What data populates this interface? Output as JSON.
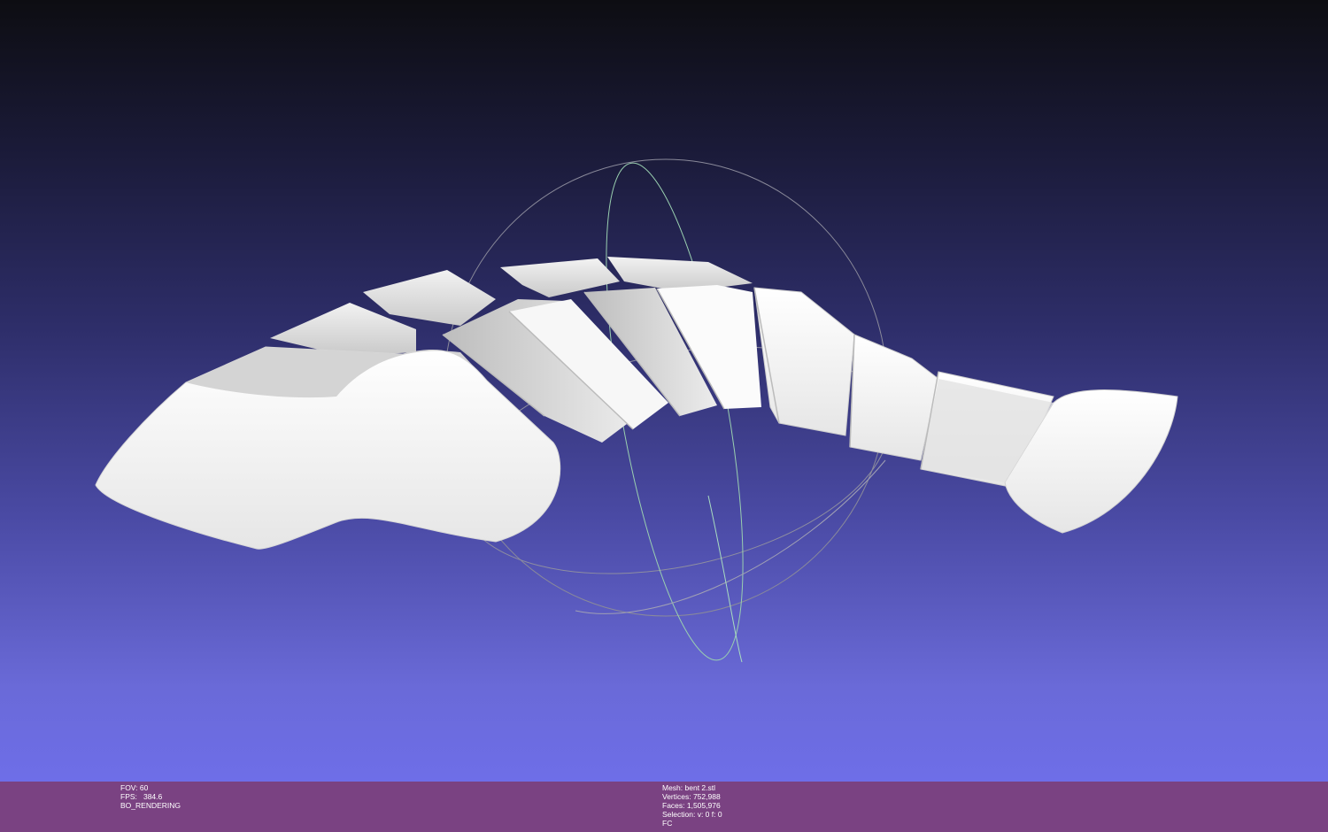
{
  "colors": {
    "background_top": "#0d0d12",
    "background_bottom": "#6e6ee8",
    "info_bar": "#7a4282",
    "mesh": "#f4f4f4",
    "trackball": "#9a9aa8"
  },
  "viewport": {
    "trackball_icon": "trackball-gizmo",
    "mesh_icon": "bent-segmented-mesh"
  },
  "info_left": {
    "fov": "FOV: 60",
    "fps": "FPS:   384.6",
    "render_mode": "BO_RENDERING"
  },
  "info_right": {
    "mesh": "Mesh: bent 2.stl",
    "vertices": "Vertices: 752,988",
    "faces": "Faces: 1,505,976",
    "selection": "Selection: v: 0 f: 0",
    "fc": "FC"
  }
}
